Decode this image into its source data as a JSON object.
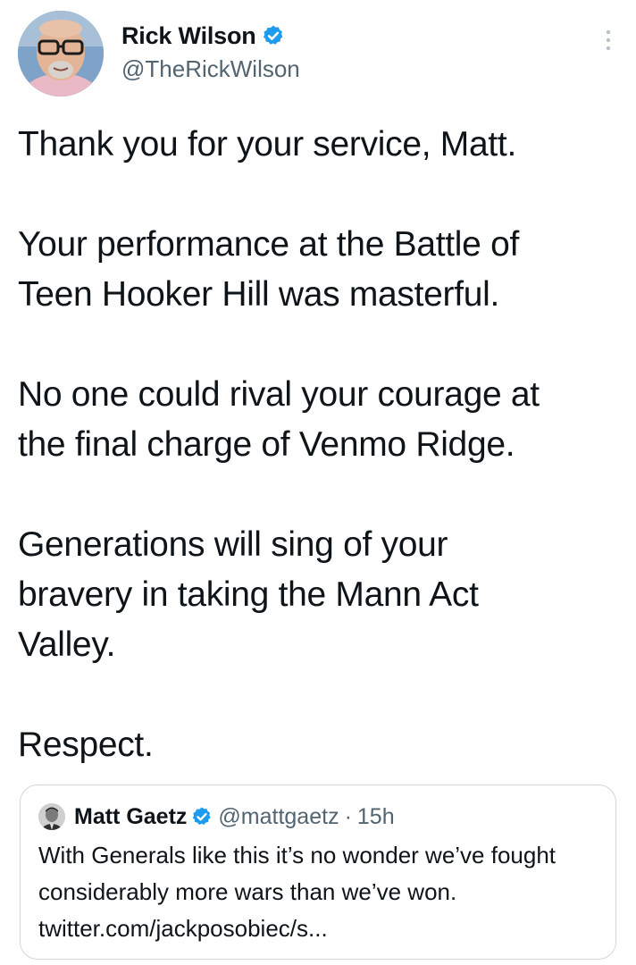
{
  "author": {
    "display_name": "Rick Wilson",
    "handle": "@TheRickWilson",
    "avatar_icon": "profile-photo",
    "verified_icon": "verified-badge-icon"
  },
  "menu_icon": "more-vertical-icon",
  "tweet": {
    "paragraphs": [
      "Thank you for your service, Matt.",
      "Your performance at the Battle of\nTeen Hooker Hill was masterful.",
      "No one could rival your courage at\nthe final charge of Venmo Ridge.",
      "Generations will sing of your\nbravery in taking the Mann Act\nValley.",
      "Respect."
    ]
  },
  "quote": {
    "display_name": "Matt Gaetz",
    "handle": "@mattgaetz",
    "separator": "·",
    "time": "15h",
    "text": "With Generals like this it’s no wonder we’ve fought considerably more wars than we’ve won. twitter.com/jackposobiec/s..."
  },
  "colors": {
    "verified": "#1d9bf0",
    "text": "#0f1419",
    "secondary": "#536471",
    "border": "#cfd9de"
  }
}
